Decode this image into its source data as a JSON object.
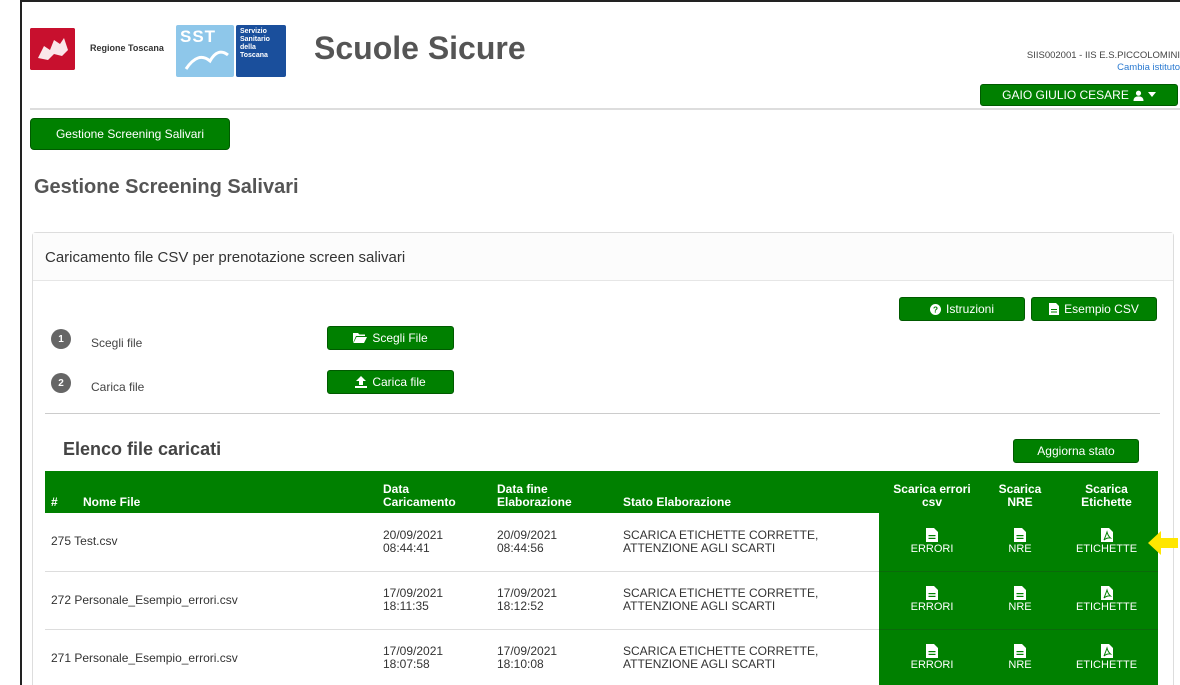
{
  "header": {
    "region_label": "Regione Toscana",
    "sst_letters": "SST",
    "sst_lines": [
      "Servizio",
      "Sanitario",
      "della",
      "Toscana"
    ],
    "app_title": "Scuole Sicure",
    "institute_code": "SIIS002001 - IIS E.S.PICCOLOMINI",
    "change_institute": "Cambia istituto",
    "user_name": "GAIO GIULIO CESARE"
  },
  "nav": {
    "screening_button": "Gestione Screening Salivari"
  },
  "page_title": "Gestione Screening Salivari",
  "panel": {
    "title": "Caricamento file CSV per prenotazione screen salivari",
    "instructions_button": "Istruzioni",
    "example_button": "Esempio CSV",
    "steps": [
      {
        "num": "1",
        "label": "Scegli file",
        "button": "Scegli File"
      },
      {
        "num": "2",
        "label": "Carica file",
        "button": "Carica file"
      }
    ],
    "list_title": "Elenco file caricati",
    "refresh_button": "Aggiorna stato"
  },
  "table": {
    "headers": {
      "hash": "#",
      "file_name": "Nome File",
      "upload_date_1": "Data",
      "upload_date_2": "Caricamento",
      "end_date_1": "Data fine",
      "end_date_2": "Elaborazione",
      "status": "Stato Elaborazione",
      "dl_errors_1": "Scarica errori",
      "dl_errors_2": "csv",
      "dl_nre_1": "Scarica",
      "dl_nre_2": "NRE",
      "dl_labels_1": "Scarica",
      "dl_labels_2": "Etichette"
    },
    "rows": [
      {
        "id_name": "275 Test.csv",
        "upload_date": "20/09/2021",
        "upload_time": "08:44:41",
        "end_date": "20/09/2021",
        "end_time": "08:44:56",
        "status_1": "SCARICA ETICHETTE CORRETTE,",
        "status_2": "ATTENZIONE AGLI SCARTI",
        "err": "ERRORI",
        "nre": "NRE",
        "lab": "ETICHETTE"
      },
      {
        "id_name": "272 Personale_Esempio_errori.csv",
        "upload_date": "17/09/2021",
        "upload_time": "18:11:35",
        "end_date": "17/09/2021",
        "end_time": "18:12:52",
        "status_1": "SCARICA ETICHETTE CORRETTE,",
        "status_2": "ATTENZIONE AGLI SCARTI",
        "err": "ERRORI",
        "nre": "NRE",
        "lab": "ETICHETTE"
      },
      {
        "id_name": "271 Personale_Esempio_errori.csv",
        "upload_date": "17/09/2021",
        "upload_time": "18:07:58",
        "end_date": "17/09/2021",
        "end_time": "18:10:08",
        "status_1": "SCARICA ETICHETTE CORRETTE,",
        "status_2": "ATTENZIONE AGLI SCARTI",
        "err": "ERRORI",
        "nre": "NRE",
        "lab": "ETICHETTE"
      }
    ]
  },
  "colors": {
    "primary_green": "#008000",
    "link_blue": "#2a7ad1",
    "arrow_yellow": "#ffe600"
  }
}
